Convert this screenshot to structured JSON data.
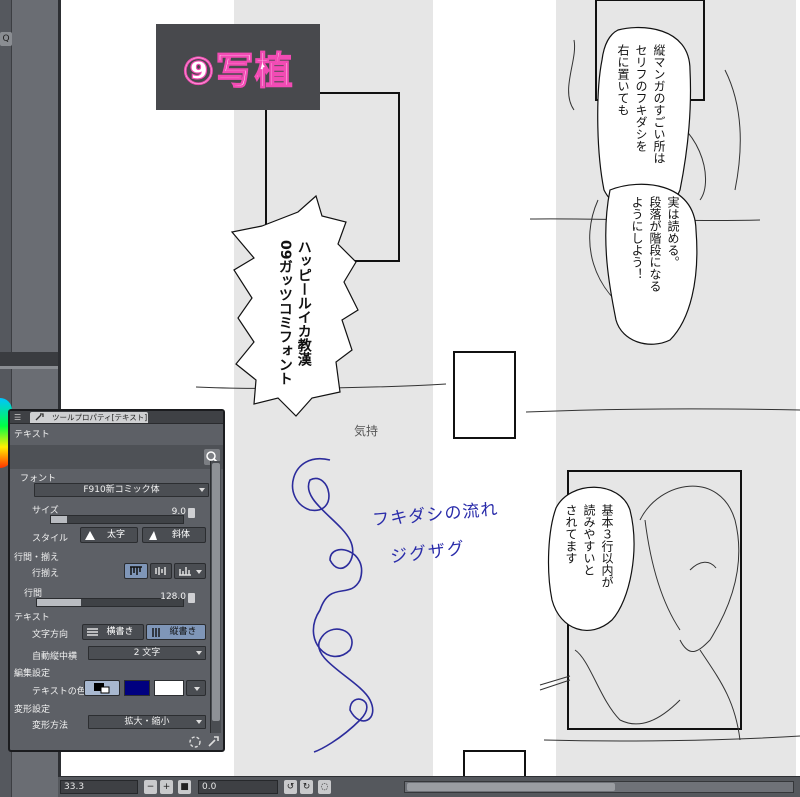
{
  "left_strip": {
    "knob_glyph": "Q"
  },
  "canvas": {
    "title_plate": {
      "text": "⑨写植"
    },
    "balloons": [
      {
        "id": "tall-balloon",
        "text": "縦マンガのすごい所は\nセリフのフキダシを\n右に置いても"
      },
      {
        "id": "mid-balloon",
        "text": "実は読める。\n段落が階段になる\nようにしよう！"
      },
      {
        "id": "low-balloon",
        "text": "基本３行以内が\n読みやすいと\nされてます"
      },
      {
        "id": "spiky-balloon",
        "text": "ハッピールイカ教漢\n09ガッツコミフォント"
      }
    ],
    "scribble": "気持",
    "notes": [
      "フキダシの流れ",
      "ジグザグ"
    ]
  },
  "tool_panel": {
    "tab_label": "ツールプロパティ[テキスト]",
    "tool_name": "テキスト",
    "font": {
      "label": "フォント",
      "value": "F910新コミック体"
    },
    "size": {
      "label": "サイズ",
      "value": "9.0",
      "fill": 0.12
    },
    "style": {
      "label": "スタイル",
      "bold": "太字",
      "italic": "斜体"
    },
    "line_spacing_section": "行間・揃え",
    "alignment_label": "行揃え",
    "line_spacing": {
      "label": "行間",
      "value": "128.0",
      "fill": 0.3
    },
    "text_section": "テキスト",
    "direction": {
      "label": "文字方向",
      "horizontal": "横書き",
      "vertical": "縦書き",
      "active": "vertical"
    },
    "auto_tate_chu_yoko": {
      "label": "自動縦中横",
      "value": "2 文字"
    },
    "edit_section": "編集設定",
    "text_color_label": "テキストの色",
    "swatches": [
      "#000080",
      "#ffffff"
    ],
    "transform_section": "変形設定",
    "transform_method": {
      "label": "変形方法",
      "value": "拡大・縮小"
    }
  },
  "status_bar": {
    "zoom": "33.3",
    "angle": "0.0",
    "scroll_thumb": 0.54
  }
}
